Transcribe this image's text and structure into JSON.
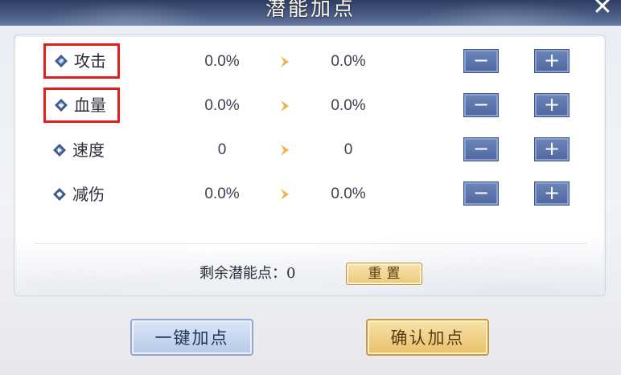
{
  "window": {
    "title": "潜能加点",
    "close_label": "✕"
  },
  "attributes": [
    {
      "name": "攻击",
      "current": "0.0%",
      "next": "0.0%",
      "icon": "attack-diamond-icon",
      "highlighted": true
    },
    {
      "name": "血量",
      "current": "0.0%",
      "next": "0.0%",
      "icon": "health-diamond-icon",
      "highlighted": true
    },
    {
      "name": "速度",
      "current": "0",
      "next": "0",
      "icon": "speed-diamond-icon",
      "highlighted": false
    },
    {
      "name": "减伤",
      "current": "0.0%",
      "next": "0.0%",
      "icon": "defense-diamond-icon",
      "highlighted": false
    }
  ],
  "stepper": {
    "minus_label": "−",
    "plus_label": "+"
  },
  "footer": {
    "remaining_label": "剩余潜能点：0",
    "reset_label": "重置"
  },
  "actions": {
    "auto_label": "一键加点",
    "confirm_label": "确认加点"
  },
  "colors": {
    "title_bar": "#3b4a72",
    "step_button": "#5a72aa",
    "highlight_border": "#e01e1e",
    "gold_button": "#ecc977",
    "blue_button": "#c3d3ee",
    "arrow": "#f0b14a"
  }
}
